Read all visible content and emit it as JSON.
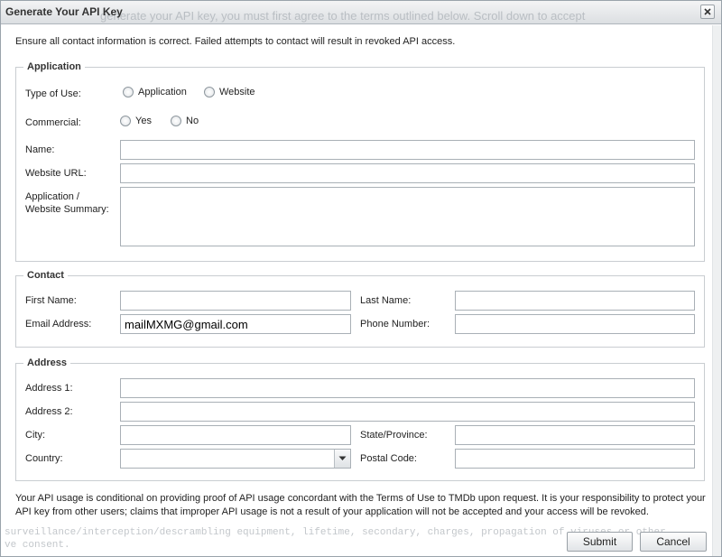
{
  "dialog": {
    "title": "Generate Your API Key",
    "ghost_text": "generate your API key, you must first agree to the terms outlined below. Scroll down to accept",
    "close_glyph": "✕"
  },
  "intro": "Ensure all contact information is correct. Failed attempts to contact will result in revoked API access.",
  "application": {
    "legend": "Application",
    "type_label": "Type of Use:",
    "type_options": [
      "Application",
      "Website"
    ],
    "commercial_label": "Commercial:",
    "commercial_options": [
      "Yes",
      "No"
    ],
    "name_label": "Name:",
    "name_value": "",
    "url_label": "Website URL:",
    "url_value": "",
    "summary_label_line1": "Application /",
    "summary_label_line2": "Website Summary:",
    "summary_value": ""
  },
  "contact": {
    "legend": "Contact",
    "first_name_label": "First Name:",
    "first_name_value": "",
    "last_name_label": "Last Name:",
    "last_name_value": "",
    "email_label": "Email Address:",
    "email_value": "mailMXMG@gmail.com",
    "phone_label": "Phone Number:",
    "phone_value": ""
  },
  "address": {
    "legend": "Address",
    "address1_label": "Address 1:",
    "address1_value": "",
    "address2_label": "Address 2:",
    "address2_value": "",
    "city_label": "City:",
    "city_value": "",
    "state_label": "State/Province:",
    "state_value": "",
    "country_label": "Country:",
    "country_value": "",
    "postal_label": "Postal Code:",
    "postal_value": ""
  },
  "disclaimer": "Your API usage is conditional on providing proof of API usage concordant with the Terms of Use to TMDb upon request. It is your responsibility to protect your API key from other users; claims that improper API usage is not a result of your application will not be accepted and your access will be revoked.",
  "background_text": {
    "line1": "surveillance/interception/descrambling equipment, lifetime, secondary, charges, propagation of viruses or other",
    "line2": "ve consent."
  },
  "buttons": {
    "submit": "Submit",
    "cancel": "Cancel"
  },
  "icons": {
    "close": "close-icon",
    "dropdown": "chevron-down-icon",
    "radio": "radio-icon"
  }
}
